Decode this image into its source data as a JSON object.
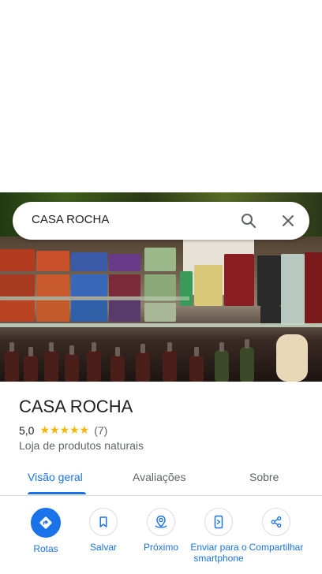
{
  "search": {
    "query": "CASA ROCHA"
  },
  "place": {
    "name": "CASA ROCHA",
    "rating": "5,0",
    "stars": "★★★★★",
    "review_count": "(7)",
    "category": "Loja de produtos naturais"
  },
  "tabs": [
    {
      "label": "Visão geral",
      "active": true
    },
    {
      "label": "Avaliações",
      "active": false
    },
    {
      "label": "Sobre",
      "active": false
    }
  ],
  "actions": [
    {
      "label": "Rotas",
      "icon": "directions-icon"
    },
    {
      "label": "Salvar",
      "icon": "bookmark-icon"
    },
    {
      "label": "Próximo",
      "icon": "nearby-icon"
    },
    {
      "label": "Enviar para o smartphone",
      "icon": "send-to-phone-icon"
    },
    {
      "label": "Compartilhar",
      "icon": "share-icon"
    }
  ],
  "colors": {
    "accent": "#1a73e8",
    "star": "#f4b400",
    "text": "#202124",
    "secondary": "#5f6368"
  }
}
